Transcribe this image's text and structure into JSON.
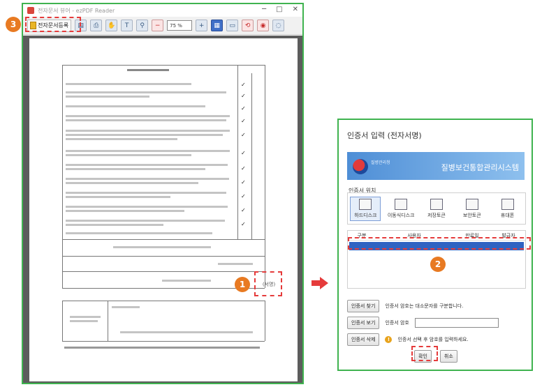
{
  "viewer": {
    "title": "전자문서 뷰어 - ezPDF Reader",
    "toolbar": {
      "sign_label": "전자문서등록",
      "zoom_value": "75 %"
    },
    "sign_cell_text": "(서명)"
  },
  "dialog": {
    "title": "인증서 입력 (전자서명)",
    "banner": {
      "sub": "질병관리청",
      "name": "질병보건통합관리시스템"
    },
    "location_label": "인증서 위치",
    "locations": [
      {
        "label": "하드디스크",
        "selected": true
      },
      {
        "label": "이동식디스크",
        "selected": false
      },
      {
        "label": "저장토큰",
        "selected": false
      },
      {
        "label": "보안토큰",
        "selected": false
      },
      {
        "label": "휴대폰",
        "selected": false
      }
    ],
    "table_headers": [
      "구분",
      "사용자",
      "만료일",
      "발급자"
    ],
    "find_button": "인증서 찾기",
    "find_desc": "인증서 암호는 대소문자를 구분합니다.",
    "view_button": "인증서 보기",
    "password_label": "인증서 암호",
    "delete_button": "인증서 삭제",
    "delete_desc": "인증서 선택 후 암호를 입력하세요.",
    "ok_button": "확인",
    "cancel_button": "취소"
  },
  "callouts": {
    "one": "1",
    "two": "2",
    "three": "3"
  },
  "colors": {
    "frame": "#3fb34f",
    "highlight": "#e53b3b",
    "badge": "#e87a22",
    "selection": "#2f63c2"
  }
}
